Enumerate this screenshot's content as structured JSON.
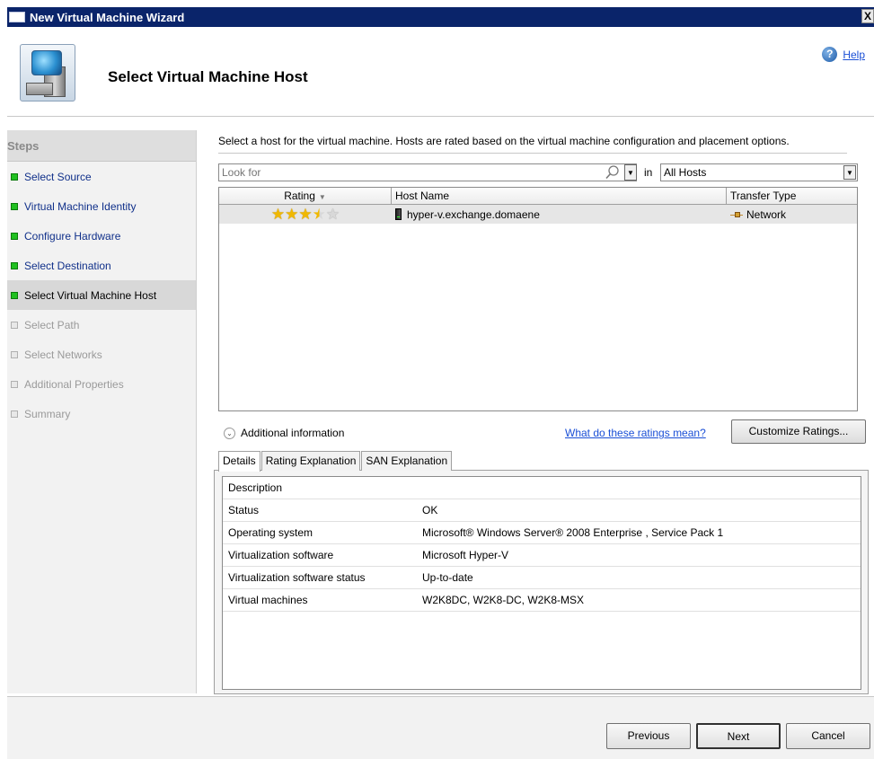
{
  "window": {
    "title": "New Virtual Machine Wizard",
    "close_glyph": "X"
  },
  "header": {
    "title": "Select Virtual Machine Host",
    "help_label": "Help",
    "help_glyph": "?"
  },
  "sidebar": {
    "title": "Steps",
    "items": [
      {
        "label": "Select Source",
        "state": "done"
      },
      {
        "label": "Virtual Machine Identity",
        "state": "done"
      },
      {
        "label": "Configure Hardware",
        "state": "done"
      },
      {
        "label": "Select Destination",
        "state": "done"
      },
      {
        "label": "Select Virtual Machine Host",
        "state": "current"
      },
      {
        "label": "Select Path",
        "state": "pending"
      },
      {
        "label": "Select Networks",
        "state": "pending"
      },
      {
        "label": "Additional Properties",
        "state": "pending"
      },
      {
        "label": "Summary",
        "state": "pending"
      }
    ]
  },
  "main": {
    "instruction": "Select a host for the virtual machine. Hosts are rated based on the virtual machine configuration and placement options.",
    "search": {
      "placeholder": "Look for",
      "in_label": "in",
      "scope_value": "All Hosts"
    },
    "host_table": {
      "columns": [
        "Rating",
        "Host Name",
        "Transfer Type"
      ],
      "rows": [
        {
          "rating": 3.5,
          "rating_max": 5,
          "host_name": "hyper-v.exchange.domaene",
          "transfer_type": "Network"
        }
      ]
    },
    "additional_info_label": "Additional information",
    "ratings_link": "What do these ratings mean?",
    "customize_button": "Customize Ratings...",
    "tabs": [
      "Details",
      "Rating Explanation",
      "SAN Explanation"
    ],
    "details": {
      "header": "Description",
      "rows": [
        {
          "key": "Status",
          "value": "OK"
        },
        {
          "key": "Operating system",
          "value": "Microsoft® Windows Server® 2008 Enterprise , Service Pack 1"
        },
        {
          "key": "Virtualization software",
          "value": "Microsoft Hyper-V"
        },
        {
          "key": "Virtualization software status",
          "value": "Up-to-date"
        },
        {
          "key": "Virtual machines",
          "value": "W2K8DC, W2K8-DC, W2K8-MSX"
        }
      ]
    }
  },
  "footer": {
    "previous": "Previous",
    "next": "Next",
    "cancel": "Cancel"
  }
}
